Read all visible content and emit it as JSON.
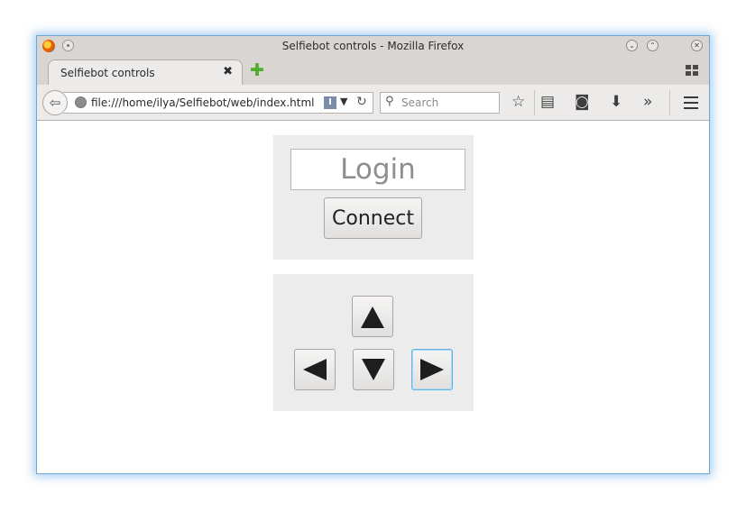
{
  "window": {
    "title": "Selfiebot controls - Mozilla Firefox",
    "buttons": {
      "minimize": "⌄",
      "maximize": "⌃",
      "close": "✕"
    }
  },
  "tabs": [
    {
      "label": "Selfiebot controls",
      "close": "✖"
    }
  ],
  "new_tab": "✚",
  "navbar": {
    "url": "file:///home/ilya/Selfiebot/web/index.html",
    "search_placeholder": "Search",
    "overflow": "»"
  },
  "page": {
    "login_placeholder": "Login",
    "connect_label": "Connect",
    "controls": {
      "up": "up-arrow-icon",
      "down": "down-arrow-icon",
      "left": "left-arrow-icon",
      "right": "right-arrow-icon"
    }
  },
  "colors": {
    "panel_bg": "#ececec",
    "focus_ring": "#63b3e3",
    "window_glow": "#64aae6"
  }
}
